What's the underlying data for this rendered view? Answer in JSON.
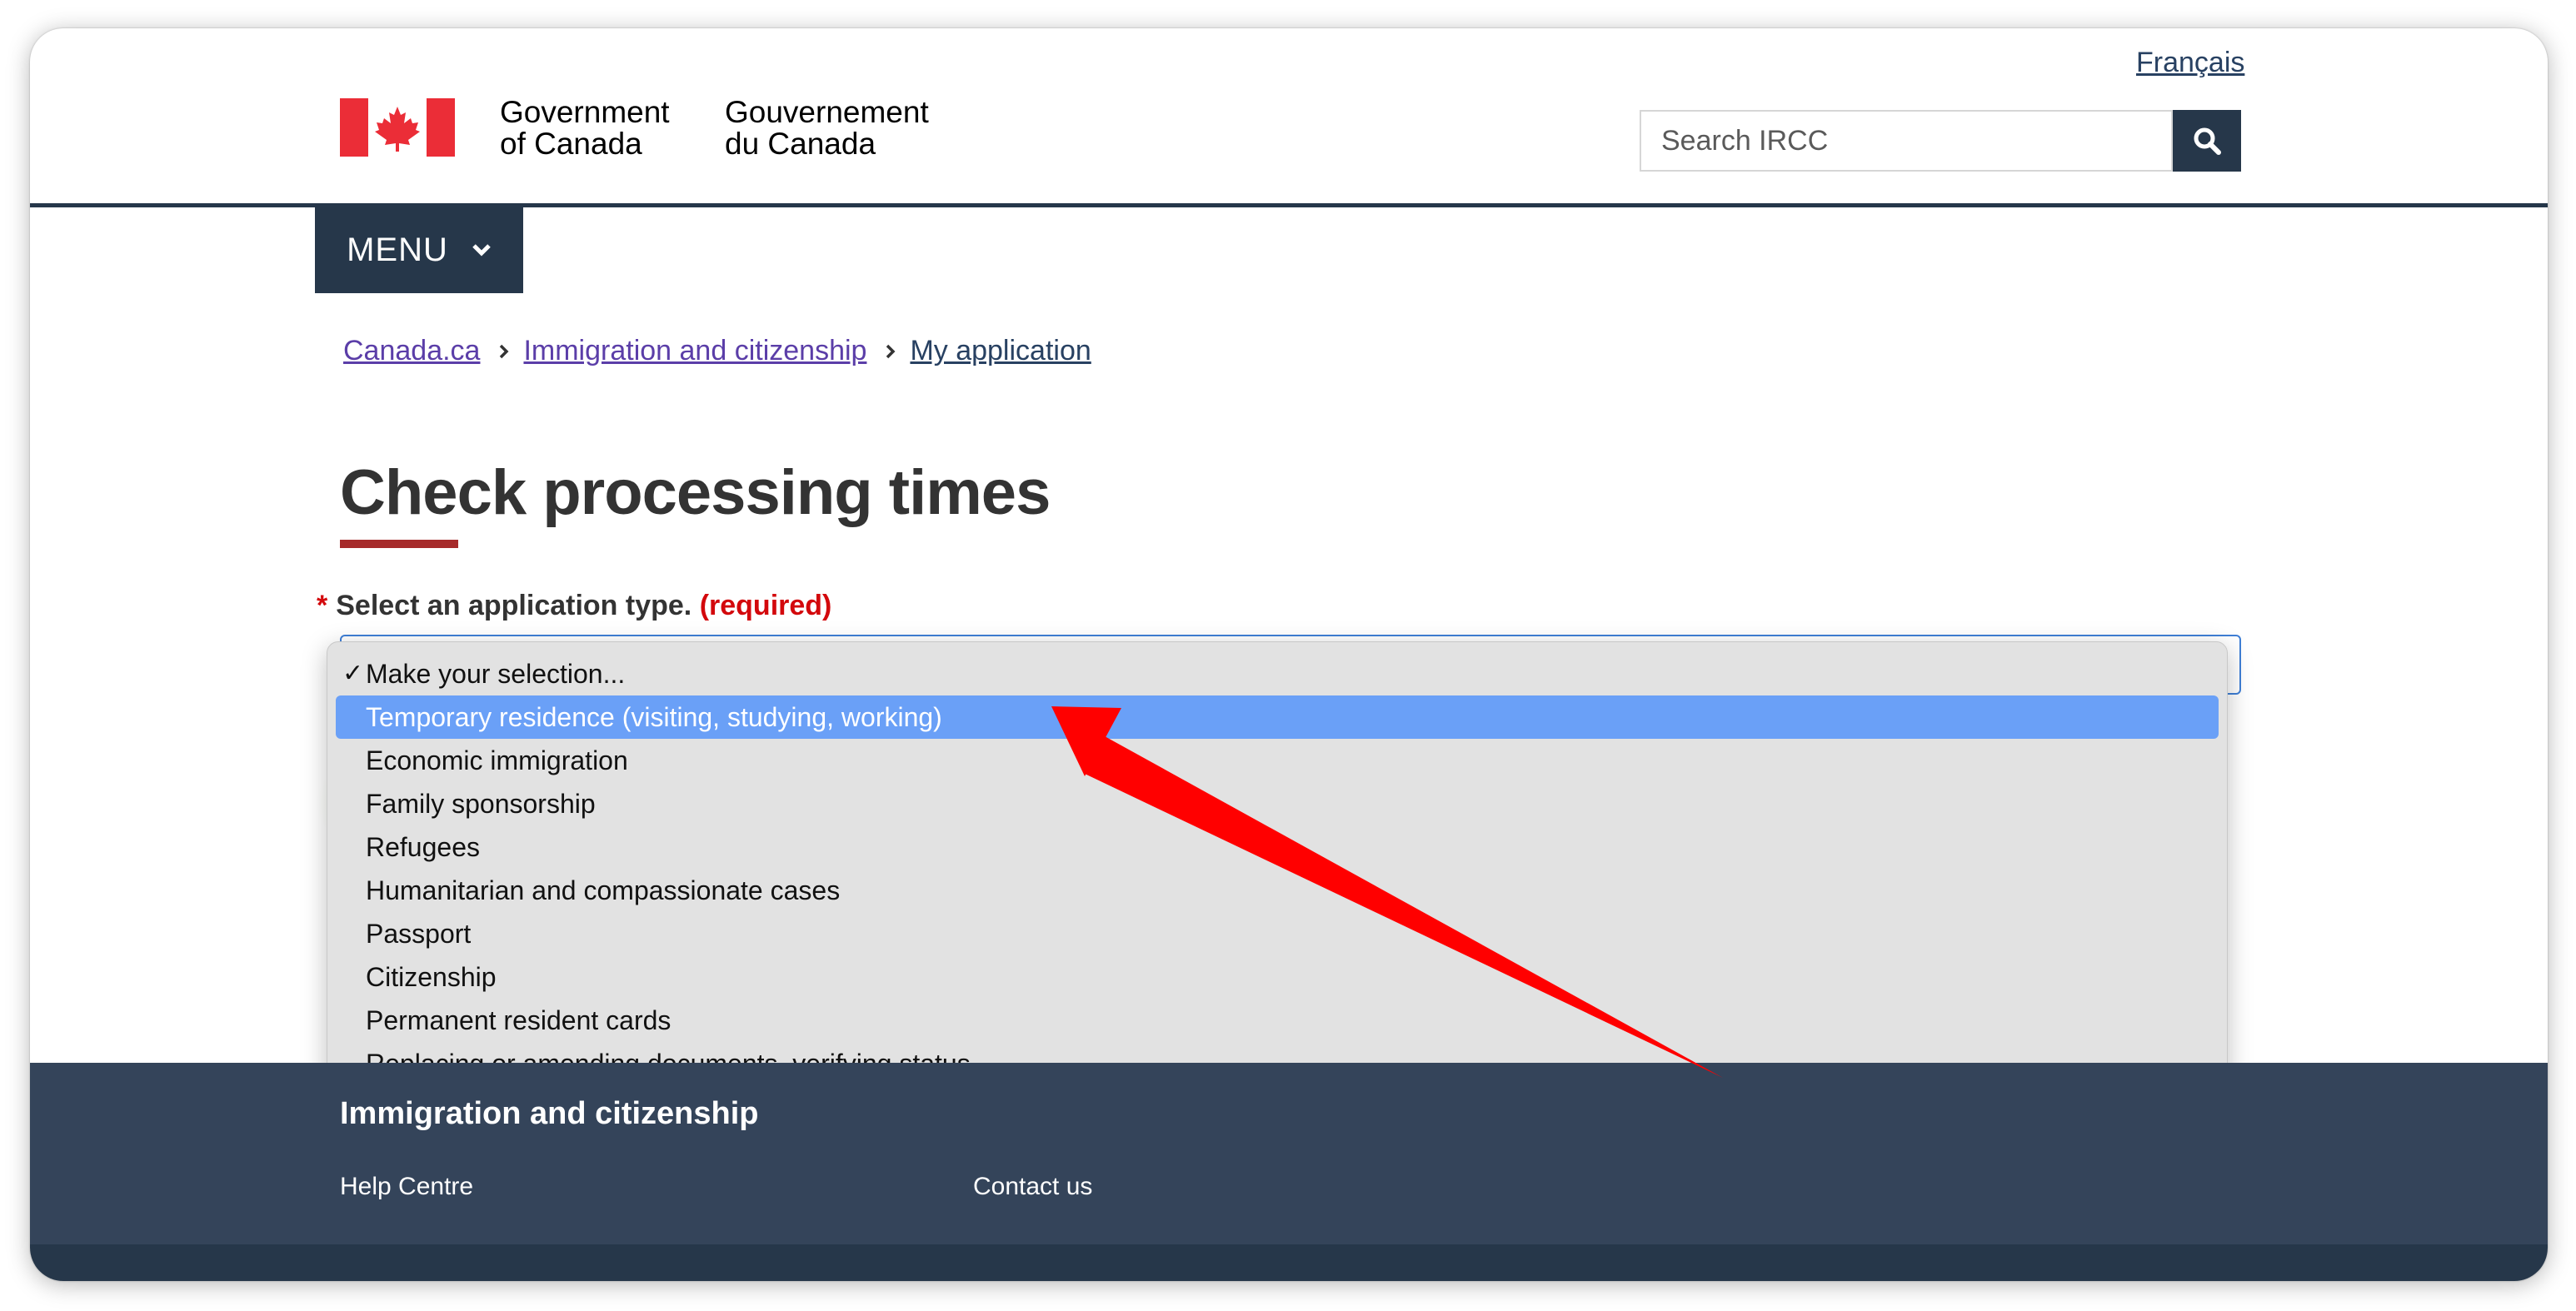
{
  "header": {
    "language_link": "Français",
    "wordmark_en_line1": "Government",
    "wordmark_en_line2": "of Canada",
    "wordmark_fr_line1": "Gouvernement",
    "wordmark_fr_line2": "du Canada",
    "search_placeholder": "Search IRCC",
    "menu_label": "MENU"
  },
  "breadcrumb": [
    "Canada.ca",
    "Immigration and citizenship",
    "My application"
  ],
  "page": {
    "title": "Check processing times",
    "field_label": "Select an application type.",
    "required_marker": "*",
    "required_text": "(required)"
  },
  "dropdown": {
    "options": [
      "Make your selection...",
      "Temporary residence (visiting, studying, working)",
      "Economic immigration",
      "Family sponsorship",
      "Refugees",
      "Humanitarian and compassionate cases",
      "Passport",
      "Citizenship",
      "Permanent resident cards",
      "Replacing or amending documents, verifying status"
    ],
    "selected_index": 0,
    "highlighted_index": 1,
    "check_mark": "✓"
  },
  "footer": {
    "title": "Immigration and citizenship",
    "links": [
      "Help Centre",
      "Contact us"
    ]
  },
  "colors": {
    "brand_navy": "#26374a",
    "footer_bg": "#34445a",
    "flag_red": "#eb2d37",
    "link_purple": "#5b3ea8",
    "highlight_blue": "#6aa0f7",
    "annotation_arrow": "#ff0000"
  }
}
